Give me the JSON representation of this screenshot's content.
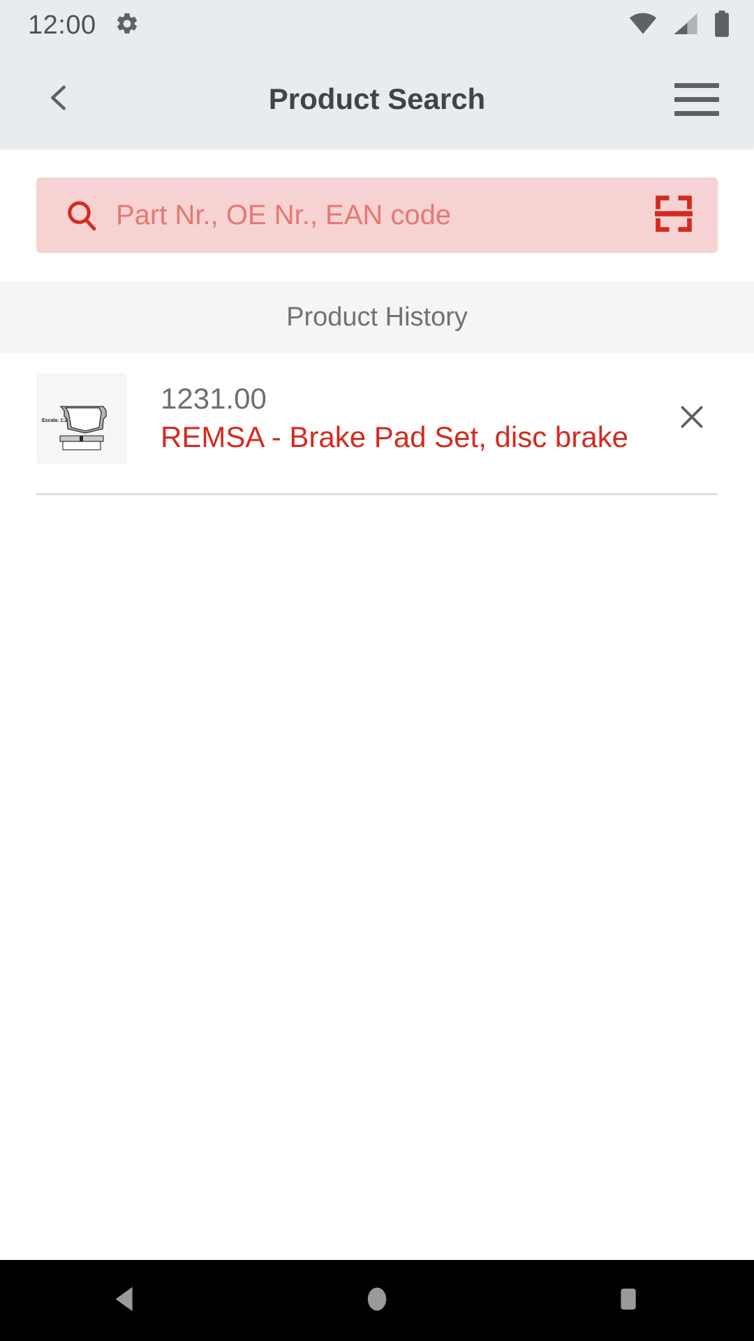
{
  "status_bar": {
    "time": "12:00",
    "icons": [
      "gear-icon",
      "wifi-icon",
      "cellular-signal-icon",
      "battery-icon"
    ]
  },
  "app_bar": {
    "title": "Product Search",
    "back_icon": "chevron-left-icon",
    "menu_icon": "hamburger-menu-icon"
  },
  "search": {
    "placeholder": "Part Nr., OE Nr., EAN code",
    "value": "",
    "search_icon": "magnifier-icon",
    "scan_icon": "barcode-scanner-icon"
  },
  "section": {
    "product_history_label": "Product History"
  },
  "history": {
    "items": [
      {
        "code": "1231.00",
        "name": "REMSA - Brake Pad Set, disc brake",
        "thumbnail_label": "Escala: 1:2",
        "thumbnail_alt": "brake-pad-technical-drawing",
        "remove_icon": "close-x-icon"
      }
    ]
  },
  "nav_bar": {
    "back_label": "back-triangle-icon",
    "home_label": "home-circle-icon",
    "recents_label": "recents-square-icon"
  },
  "colors": {
    "accent_red": "#D32B1E",
    "search_background": "#F7D2D2",
    "app_bar_background": "#E8EBEF",
    "section_background": "#F5F5F5",
    "placeholder_red": "#E27A72"
  }
}
